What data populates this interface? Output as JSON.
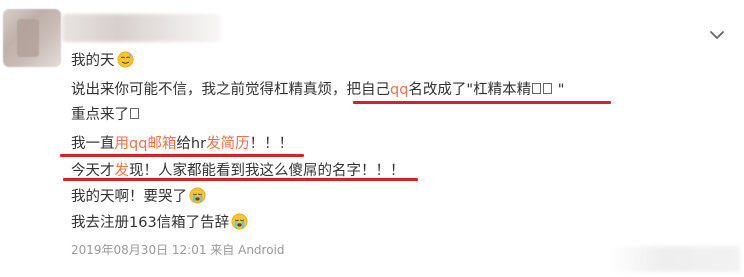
{
  "post": {
    "line1": "我的天",
    "line2a": "说出来你可能不信，我之前觉得杠精真烦，把自己",
    "line2b": "qq",
    "line2c": "名改成了\"杠精本精",
    "line2d": " \"",
    "line3": "重点来了",
    "line4a": "我一直",
    "line4b": "用qq邮箱",
    "line4c": "给hr",
    "line4d": "发简历",
    "line4e": "！！！",
    "line5a": "今天才",
    "line5b": "发",
    "line5c": "现！人家都能看到我这么傻屌的名字！！！",
    "line6": "我的天啊！要哭了",
    "line7": "我去注册163信箱了告辞",
    "meta": "2019年08月30日 12:01  来自 Android"
  },
  "colors": {
    "highlight": "#eb7350",
    "underline": "#d1232f",
    "meta": "#999999"
  },
  "icons": [
    "chevron-down-icon",
    "awkward-emoji-icon",
    "crying-emoji-icon"
  ]
}
